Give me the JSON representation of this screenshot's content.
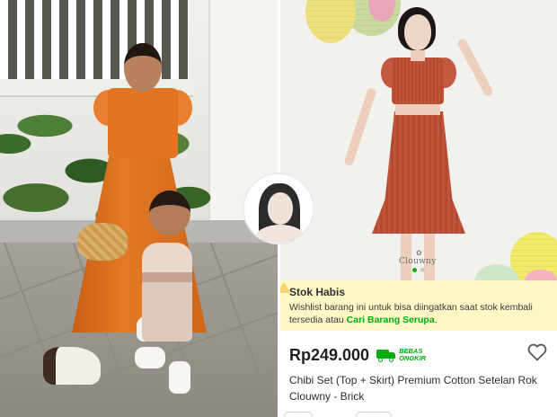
{
  "left_photo": {
    "description_alt": "",
    "avatar_icon": "illustrated-portrait-icon"
  },
  "product": {
    "watermark": "Clouwny",
    "carousel": {
      "count": 2,
      "active": 0
    },
    "stock": {
      "title": "Stok Habis",
      "desc_part1": "Wishlist barang ini untuk bisa diingatkan saat stok kembali tersedia atau ",
      "link": "Cari Barang Serupa",
      "desc_part2": "."
    },
    "price": "Rp249.000",
    "shipping_badge": {
      "line1": "BEBAS",
      "line2": "ONGKIR",
      "icon": "truck-icon"
    },
    "wishlist_icon": "heart-icon",
    "title": "Chibi Set (Top + Skirt) Premium Cotton Setelan Rok Clouwny - Brick"
  },
  "colors": {
    "accent_green": "#03ac0e",
    "banner_bg": "#fff7c6",
    "dress_orange": "#e27523",
    "dress_brick": "#c0553c"
  }
}
